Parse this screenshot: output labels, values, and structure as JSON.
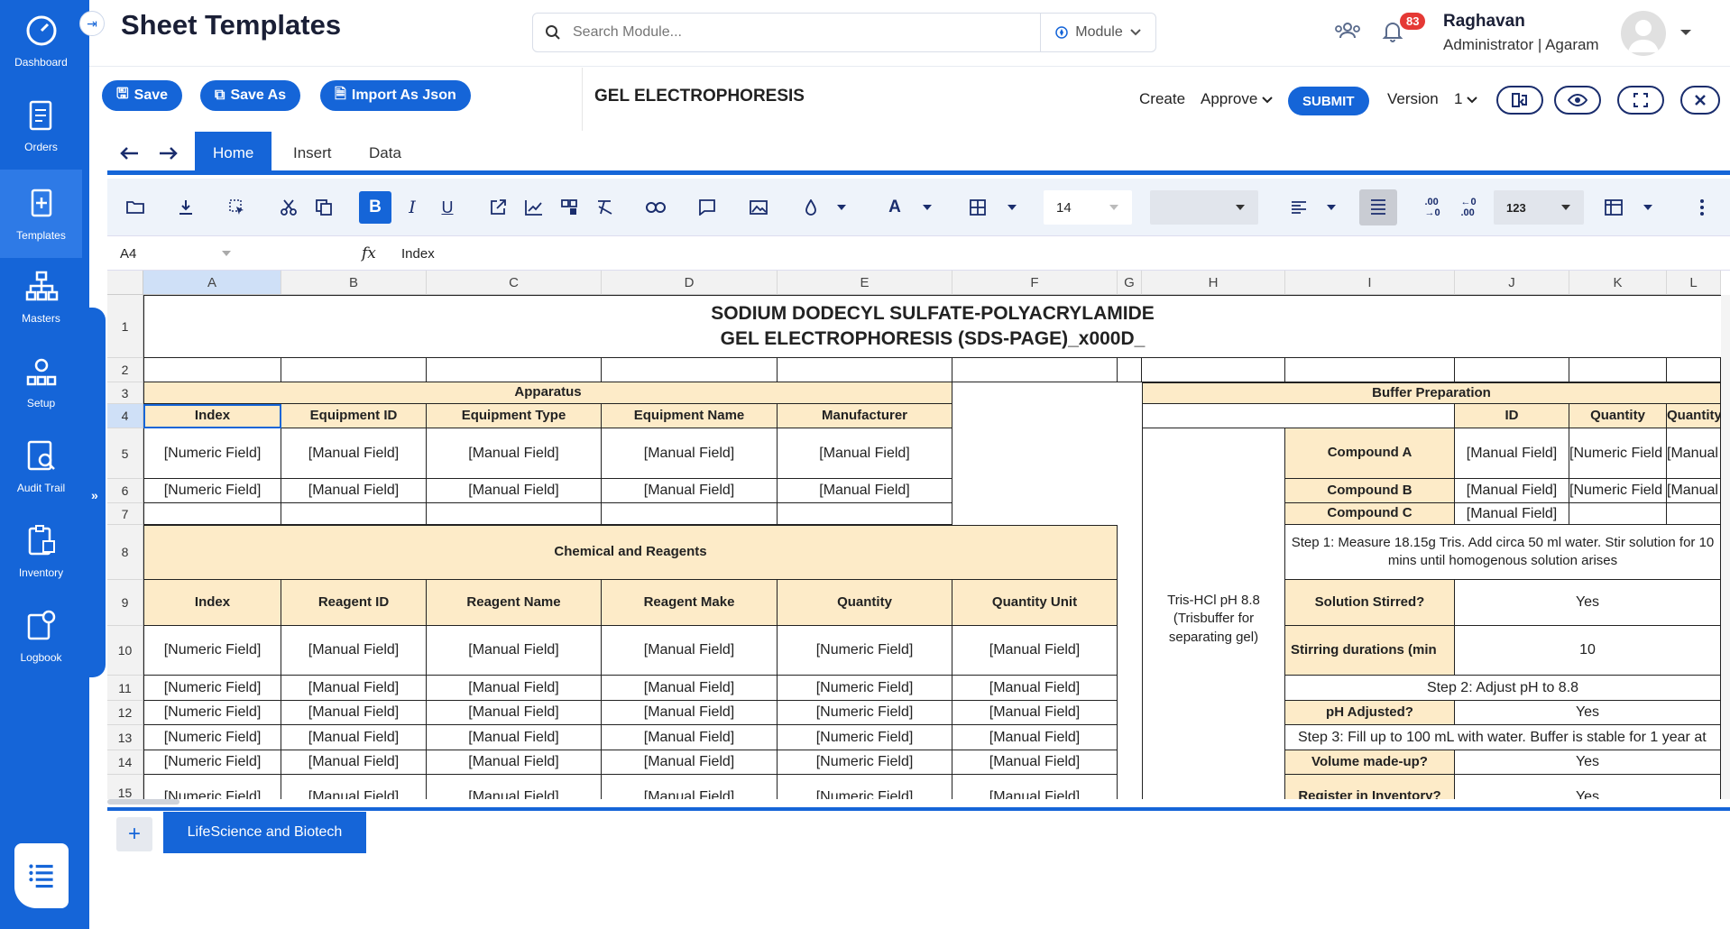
{
  "sidebar": {
    "items": [
      {
        "label": "Dashboard",
        "icon": "dashboard-icon"
      },
      {
        "label": "Orders",
        "icon": "orders-icon"
      },
      {
        "label": "Templates",
        "icon": "templates-icon"
      },
      {
        "label": "Masters",
        "icon": "masters-icon"
      },
      {
        "label": "Setup",
        "icon": "setup-icon"
      },
      {
        "label": "Audit Trail",
        "icon": "audit-trail-icon"
      },
      {
        "label": "Inventory",
        "icon": "inventory-icon"
      },
      {
        "label": "Logbook",
        "icon": "logbook-icon"
      }
    ],
    "active": "Templates"
  },
  "header": {
    "title": "Sheet Templates",
    "search_placeholder": "Search Module...",
    "module_label": "Module",
    "notification_count": "83",
    "user_name": "Raghavan",
    "user_role": "Administrator | Agaram"
  },
  "actions": {
    "save": "Save",
    "save_as": "Save As",
    "import_json": "Import As Json",
    "sheet_name": "GEL ELECTROPHORESIS",
    "create": "Create",
    "approve": "Approve",
    "submit": "SUBMIT",
    "version_label": "Version",
    "version_value": "1"
  },
  "tabs": [
    "Home",
    "Insert",
    "Data"
  ],
  "toolbar": {
    "font_size": "14",
    "number_format": "123"
  },
  "formula_bar": {
    "cell_ref": "A4",
    "fx": "fx",
    "value": "Index"
  },
  "grid": {
    "columns": [
      "A",
      "B",
      "C",
      "D",
      "E",
      "F",
      "G",
      "H",
      "I",
      "J",
      "K",
      "L"
    ],
    "rows": [
      "1",
      "2",
      "3",
      "4",
      "5",
      "6",
      "7",
      "8",
      "9",
      "10",
      "11",
      "12",
      "13",
      "14",
      "15"
    ],
    "title_line1": "SODIUM DODECYL SULFATE-POLYACRYLAMIDE",
    "title_line2": "GEL ELECTROPHORESIS (SDS-PAGE)_x000D_",
    "apparatus": "Apparatus",
    "apparatus_headers": [
      "Index",
      "Equipment ID",
      "Equipment Type",
      "Equipment Name",
      "Manufacturer"
    ],
    "numeric_field": "[Numeric Field]",
    "manual_field": "[Manual Field]",
    "chemicals": "Chemical and Reagents",
    "chemical_headers": [
      "Index",
      "Reagent ID",
      "Reagent Name",
      "Reagent Make",
      "Quantity",
      "Quantity Unit"
    ],
    "buffer": "Buffer Preparation",
    "buffer_headers": [
      "ID",
      "Quantity",
      "Quantity"
    ],
    "trishcl": "Tris-HCl pH 8.8 (Trisbuffer for separating gel)",
    "compound_a": "Compound A",
    "compound_b": "Compound B",
    "compound_c": "Compound C",
    "numeric_field_cut": "[Numeric Field",
    "manual_cut": "[Manual",
    "step1": "Step 1: Measure 18.15g Tris. Add circa 50 ml water. Stir solution for 10 mins until homogenous solution arises",
    "solution_stirred": "Solution Stirred?",
    "yes": "Yes",
    "stirring_duration": "Stirring durations (min",
    "ten": "10",
    "step2": "Step 2: Adjust pH to 8.8",
    "ph_adjusted": "pH Adjusted?",
    "step3": "Step 3: Fill up to 100 mL with water. Buffer is stable for 1 year at",
    "volume_madeup": "Volume made-up?",
    "register_inventory": "Register in Inventory?"
  },
  "sheet_tab": "LifeScience and Biotech"
}
